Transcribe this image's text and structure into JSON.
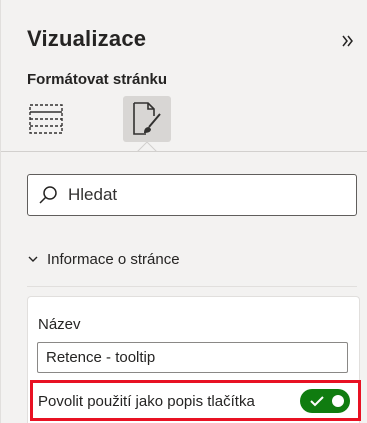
{
  "pane": {
    "title": "Vizualizace",
    "collapse_icon": "double-chevron-right-icon",
    "subtitle": "Formátovat stránku",
    "tabs": [
      {
        "name": "page-layout",
        "icon": "dashed-grid-icon",
        "selected": false
      },
      {
        "name": "format-page",
        "icon": "paint-brush-page-icon",
        "selected": true
      }
    ]
  },
  "search": {
    "placeholder": "Hledat",
    "value": "",
    "icon": "search-icon"
  },
  "section": {
    "label": "Informace o stránce",
    "expanded": true,
    "icon": "chevron-down-icon"
  },
  "page_info": {
    "name_label": "Název",
    "name_value": "Retence - tooltip",
    "tooltip_label": "Povolit použití jako popis tlačítka",
    "tooltip_enabled": true
  },
  "colors": {
    "toggle_on": "#107c10",
    "highlight": "#e81123",
    "pane_background": "#f3f2f1"
  }
}
